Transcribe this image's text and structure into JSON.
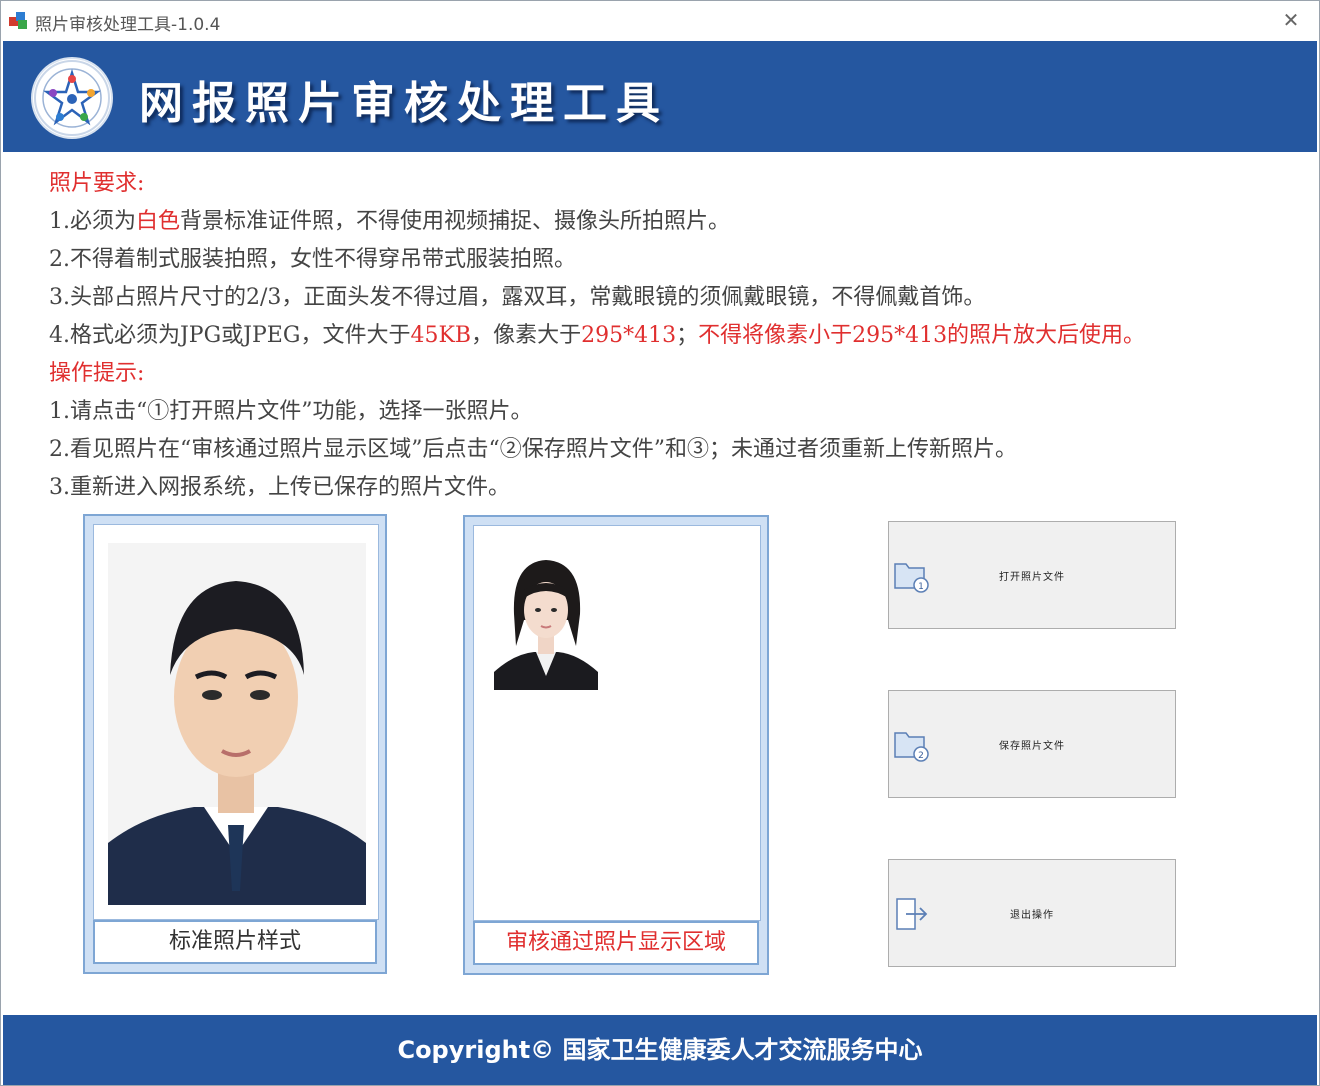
{
  "window": {
    "title": "照片审核处理工具-1.0.4",
    "close_glyph": "✕"
  },
  "header": {
    "title": "网报照片审核处理工具",
    "brand_color": "#2557a0"
  },
  "requirements": {
    "heading": "照片要求:",
    "line1": {
      "prefix": "1.必须为",
      "highlight": "白色",
      "suffix": "背景标准证件照，不得使用视频捕捉、摄像头所拍照片。"
    },
    "line2": "2.不得着制式服装拍照，女性不得穿吊带式服装拍照。",
    "line3": "3.头部占照片尺寸的2/3，正面头发不得过眉，露双耳，常戴眼镜的须佩戴眼镜，不得佩戴首饰。",
    "line4": {
      "p1": "4.格式必须为JPG或JPEG，文件大于",
      "h1": "45KB",
      "p2": "，像素大于",
      "h2": "295*413",
      "p3": "；",
      "h3": "不得将像素小于295*413的照片放大后使用。"
    }
  },
  "instructions": {
    "heading": "操作提示:",
    "line1": "1.请点击“①打开照片文件”功能，选择一张照片。",
    "line2": "2.看见照片在“审核通过照片显示区域”后点击“②保存照片文件”和③；未通过者须重新上传新照片。",
    "line3": "3.重新进入网报系统，上传已保存的照片文件。"
  },
  "sample_panel": {
    "caption": "标准照片样式"
  },
  "result_panel": {
    "caption": "审核通过照片显示区域"
  },
  "buttons": {
    "open": {
      "label": "打开照片文件",
      "icon": "folder-open-icon"
    },
    "save": {
      "label": "保存照片文件",
      "icon": "folder-save-icon"
    },
    "exit": {
      "label": "退出操作",
      "icon": "exit-icon"
    }
  },
  "footer": {
    "text": "Copyright©  国家卫生健康委人才交流服务中心"
  },
  "colors": {
    "accent": "#2557a0",
    "warning": "#e02f2f",
    "panel_border": "#7ea6d4"
  }
}
